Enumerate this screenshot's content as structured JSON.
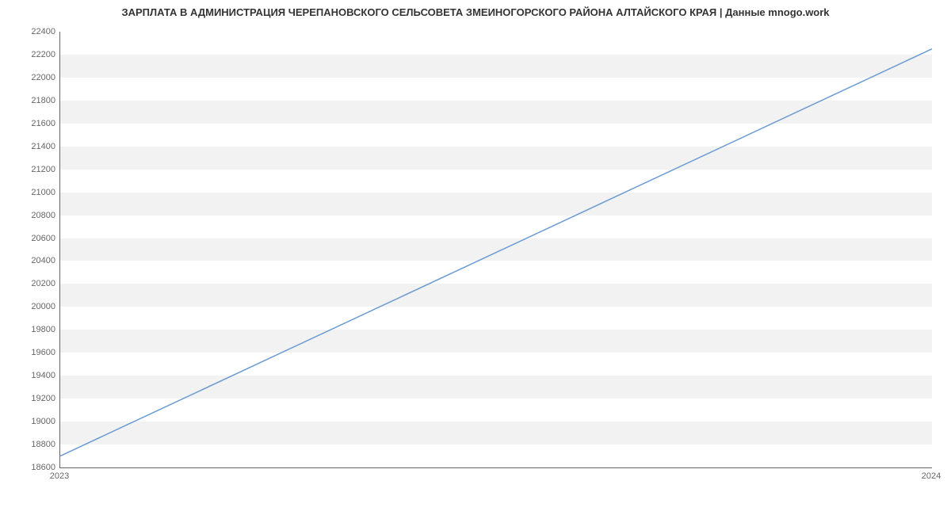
{
  "chart_data": {
    "type": "line",
    "title": "ЗАРПЛАТА В АДМИНИСТРАЦИЯ ЧЕРЕПАНОВСКОГО СЕЛЬСОВЕТА ЗМЕИНОГОРСКОГО РАЙОНА АЛТАЙСКОГО КРАЯ | Данные mnogo.work",
    "x": [
      2023,
      2024
    ],
    "values": [
      18700,
      22250
    ],
    "xlabel": "",
    "ylabel": "",
    "ylim": [
      18600,
      22400
    ],
    "y_ticks": [
      18600,
      18800,
      19000,
      19200,
      19400,
      19600,
      19800,
      20000,
      20200,
      20400,
      20600,
      20800,
      21000,
      21200,
      21400,
      21600,
      21800,
      22000,
      22200,
      22400
    ],
    "x_ticks": [
      2023,
      2024
    ]
  }
}
